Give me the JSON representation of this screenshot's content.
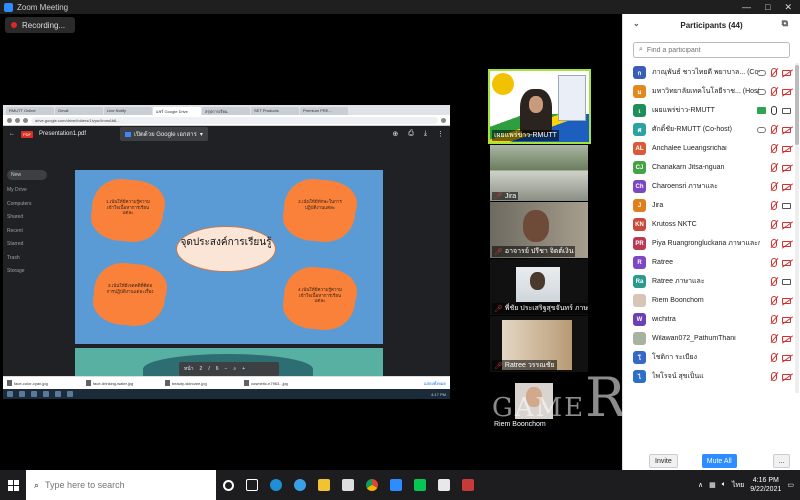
{
  "window": {
    "title": "Zoom Meeting",
    "controls": [
      "—",
      "□",
      "✕"
    ]
  },
  "recording": {
    "label": "Recording..."
  },
  "shared": {
    "browser_tabs": [
      "RMUTT Online",
      "Gmail",
      "Line Notify",
      "แชร์ Google Drive",
      "สรุปการเรียน",
      "SET Products",
      "Premium PRE..."
    ],
    "url": "drive.google.com/drive/folders/1ivpwXmmAb8...",
    "viewer": {
      "file_name": "Presentation1.pdf",
      "open_with": "เปิดด้วย Google เอกสาร"
    },
    "drive_side": [
      "New",
      "My Drive",
      "Computers",
      "Shared",
      "Recent",
      "Starred",
      "Trash",
      "Storage"
    ],
    "slide": {
      "center_title": "จุดประสงค์การเรียนรู้",
      "bubbles": [
        "1.เน้นให้มีความรู้ความเข้าใจเนื้อหาการเรียนแต่ละ",
        "2.เน้นให้มีทักษะในการปฏิบัติงานแต่ละ",
        "3.เน้นให้มีเจตคติที่ดีต่อการปฏิบัติงานแต่ละเรื่อง",
        "4.เน้นให้มีความรู้ความเข้าใจเนื้อหาการเรียนแต่ละ"
      ]
    },
    "pager": {
      "label": "หน้า",
      "page": "2",
      "sep": "/",
      "total": "6"
    },
    "downloads": [
      "face-color-cyan.jpg",
      "face-drinking-water.jpg",
      "beauty-skincare.jpg",
      "cosmetic-n7963...jpg"
    ],
    "downloads_show_all": "แสดงทั้งหมด",
    "inner_clock": "4:17 PM"
  },
  "tiles": {
    "active_name": "เผยแพร่ข่าว-RMUTT",
    "t2_name": "Jira",
    "t3_name": "อาจารย์ ปรีชา จิตต์เงิน",
    "t4_name": "พี่ชัย ประเสริฐสุขจันทร์ ภาษาและ...",
    "t5_name": "Ratree วรรณชัย",
    "t6_name": "Riem Boonchom"
  },
  "watermark": {
    "small": "GAME",
    "big": "R"
  },
  "participants": {
    "title": "Participants (44)",
    "search_placeholder": "Find a participant",
    "list": [
      {
        "initials": "ก",
        "name": "ภาณุพันธ์ ชาวไทยดี พยาบาล... (Co-host, me)",
        "color": "#3a5db8"
      },
      {
        "initials": "ม",
        "name": "มหาวิทยาลัยเทคโนโลยีราช... (Host)",
        "color": "#e08a1e"
      },
      {
        "initials": "เ",
        "name": "เผยแพร่ข่าว-RMUTT",
        "color": "#1f8f5a"
      },
      {
        "initials": "ศ",
        "name": "ศักดิ์ชัย-RMUTT (Co-host)",
        "color": "#2aa3a1"
      },
      {
        "initials": "AL",
        "name": "Anchalee Lueangsrichai",
        "color": "#d85a38"
      },
      {
        "initials": "CJ",
        "name": "Chanakarn Jitsa-nguan",
        "color": "#45a346"
      },
      {
        "initials": "Ch",
        "name": "Charoensri ภาษาและ",
        "color": "#7d47c2"
      },
      {
        "initials": "J",
        "name": "Jira",
        "color": "#e07f1c"
      },
      {
        "initials": "KN",
        "name": "Krutoss NKTC",
        "color": "#c94a3a"
      },
      {
        "initials": "PR",
        "name": "Piya Ruangrongluckana ภาษาและการ",
        "color": "#b83a52"
      },
      {
        "initials": "R",
        "name": "Ratree",
        "color": "#7e47c4"
      },
      {
        "initials": "Ra",
        "name": "Ratree ภาษาและ",
        "color": "#2a9a8c"
      },
      {
        "initials": "",
        "name": "Riem Boonchom",
        "color": "#d9c5b8"
      },
      {
        "initials": "W",
        "name": "wichitra",
        "color": "#6b3fb8"
      },
      {
        "initials": "",
        "name": "Wilawan072_PathumThani",
        "color": "#a7b3a0"
      },
      {
        "initials": "โ",
        "name": "โชติกา ระเบียง",
        "color": "#3569c9"
      },
      {
        "initials": "ไ",
        "name": "ไพโรจน์ สุขเป็นแ",
        "color": "#2c6fc4"
      }
    ],
    "invite_label": "Invite",
    "mute_all_label": "Mute All",
    "more_label": "..."
  },
  "taskbar": {
    "search_placeholder": "Type here to search",
    "time": "4:16 PM",
    "date": "9/22/2021",
    "lang": "ไทย"
  }
}
